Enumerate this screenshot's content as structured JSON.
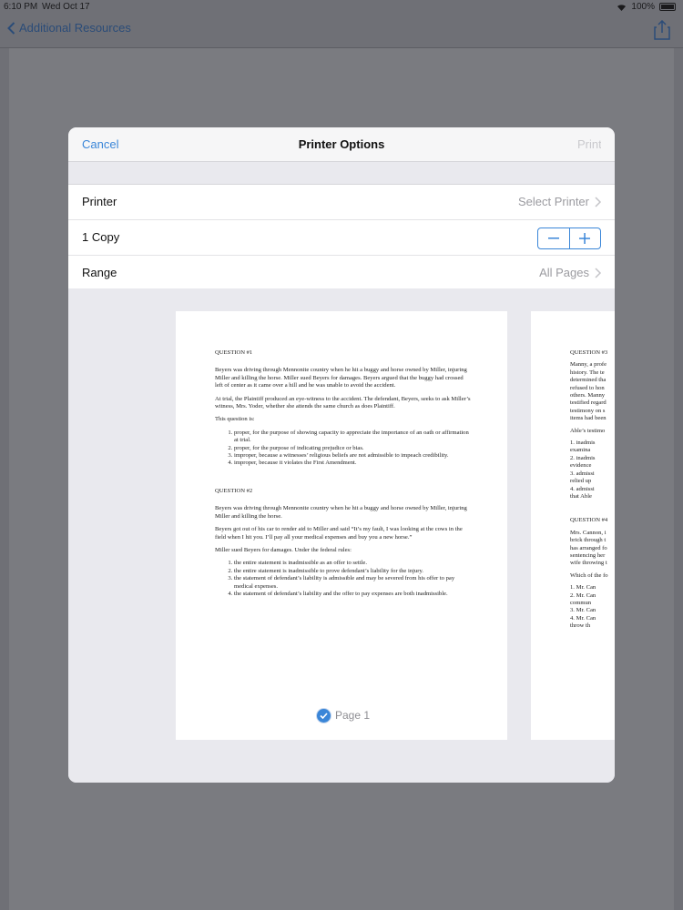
{
  "status": {
    "time": "6:10 PM",
    "date": "Wed Oct 17",
    "battery": "100%"
  },
  "nav": {
    "back_label": "Additional Resources"
  },
  "dialog": {
    "cancel": "Cancel",
    "title": "Printer Options",
    "print": "Print"
  },
  "options": {
    "printer_label": "Printer",
    "printer_value": "Select Printer",
    "copies_label": "1 Copy",
    "range_label": "Range",
    "range_value": "All Pages"
  },
  "preview": {
    "page_label": "Page 1",
    "page1": {
      "q1_title": "QUESTION #1",
      "q1_p1": "Beyers was driving through Mennonite country when he hit a buggy and horse owned by Miller, injuring Miller and killing the horse. Miller sued Beyers for damages. Beyers argued that the buggy had crossed left of center as it came over a hill and he was unable to avoid the accident.",
      "q1_p2": "At trial, the Plaintiff produced an eye-witness to the accident. The defendant, Beyers, seeks to ask Miller’s witness, Mrs. Yoder, whether she attends the same church as does Plaintiff.",
      "q1_p3": "This question is:",
      "q1_options": [
        "proper, for the purpose of showing capacity to appreciate the importance of an oath or affirmation at trial.",
        "proper, for the purpose of indicating prejudice or bias.",
        "improper, because a witnesses’ religious beliefs are not admissible to impeach credibility.",
        "improper, because it violates the First Amendment."
      ],
      "q2_title": "QUESTION #2",
      "q2_p1": "Beyers was driving through Mennonite country when he hit a buggy and horse owned by Miller, injuring Miller and killing the horse.",
      "q2_p2": "Beyers got out of his car to render aid to Miller and said “It’s my fault, I was looking at the cows in the field when I hit you. I’ll pay all your medical expenses and buy you a new horse.”",
      "q2_p3": "Miller sued Beyers for damages. Under the federal rules:",
      "q2_options": [
        "the entire statement is inadmissible as an offer to settle.",
        "the entire statement is inadmissible to prove defendant’s liability for the injury.",
        "the statement of defendant’s liability is admissible and may be severed from his offer to pay medical expenses.",
        "the statement of defendant’s liability and the offer to pay expenses are both inadmissible."
      ]
    },
    "page2_lines_a": [
      "QUESTION #3",
      "",
      "Manny, a profe",
      "history. The te",
      "determined tha",
      "refused to hon",
      "others. Manny",
      "testified regard",
      "testimony on s",
      "items had been",
      "",
      "Able’s testimo",
      "",
      "1. inadmis",
      "    examina",
      "2. inadmis",
      "    evidence",
      "3. admissi",
      "    relied up",
      "4. admissi",
      "    that Able"
    ],
    "page2_lines_b": [
      "QUESTION #4",
      "",
      "Mrs. Cannon, i",
      "brick through t",
      "has arranged fo",
      "sentencing her",
      "wife throwing t",
      "",
      "Which of the fo",
      "",
      "1. Mr. Can",
      "2. Mr. Can",
      "    commun",
      "3. Mr. Can",
      "4. Mr. Can",
      "    throw th"
    ]
  }
}
